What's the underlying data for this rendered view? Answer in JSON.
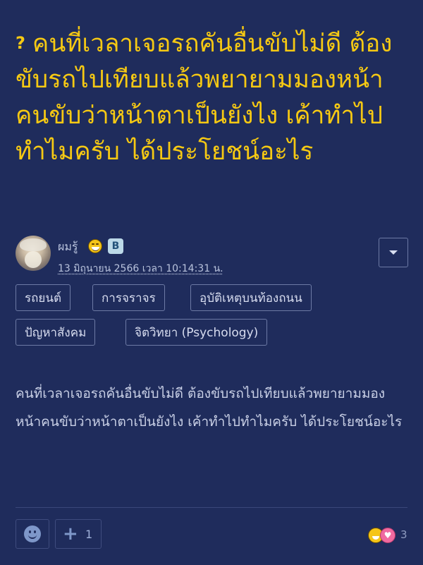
{
  "topic": {
    "badge": "?",
    "title": "คนที่เวลาเจอรถคันอื่นขับไม่ดี ต้องขับรถไปเทียบแล้วพยายามมองหน้าคนขับว่าหน้าตาเป็นยังไง เค้าทำไปทำไมครับ ได้ประโยชน์อะไร",
    "body": "คนที่เวลาเจอรถคันอื่นขับไม่ดี ต้องขับรถไปเทียบแล้วพยายามมองหน้าคนขับว่าหน้าตาเป็นยังไง เค้าทำไปทำไมครับ ได้ประโยชน์อะไร"
  },
  "author": {
    "name": "ผมรู้",
    "member_badge": "B",
    "posted_at": "13 มิถุนายน 2566 เวลา 10:14:31 น."
  },
  "tags": [
    "รถยนต์",
    "การจราจร",
    "อุบัติเหตุบนท้องถนน",
    "ปัญหาสังคม",
    "จิตวิทยา (Psychology)"
  ],
  "actions": {
    "plus_count": "1",
    "reaction_count": "3"
  },
  "icons": {
    "menu": "caret-down-icon",
    "react": "smile-icon",
    "plus": "plus-icon",
    "reactions": [
      "laugh-emoji",
      "love-emoji"
    ]
  },
  "colors": {
    "background": "#1f2c5c",
    "title": "#f6c913",
    "border": "#6d7aa5",
    "text": "#c9d0e6"
  }
}
